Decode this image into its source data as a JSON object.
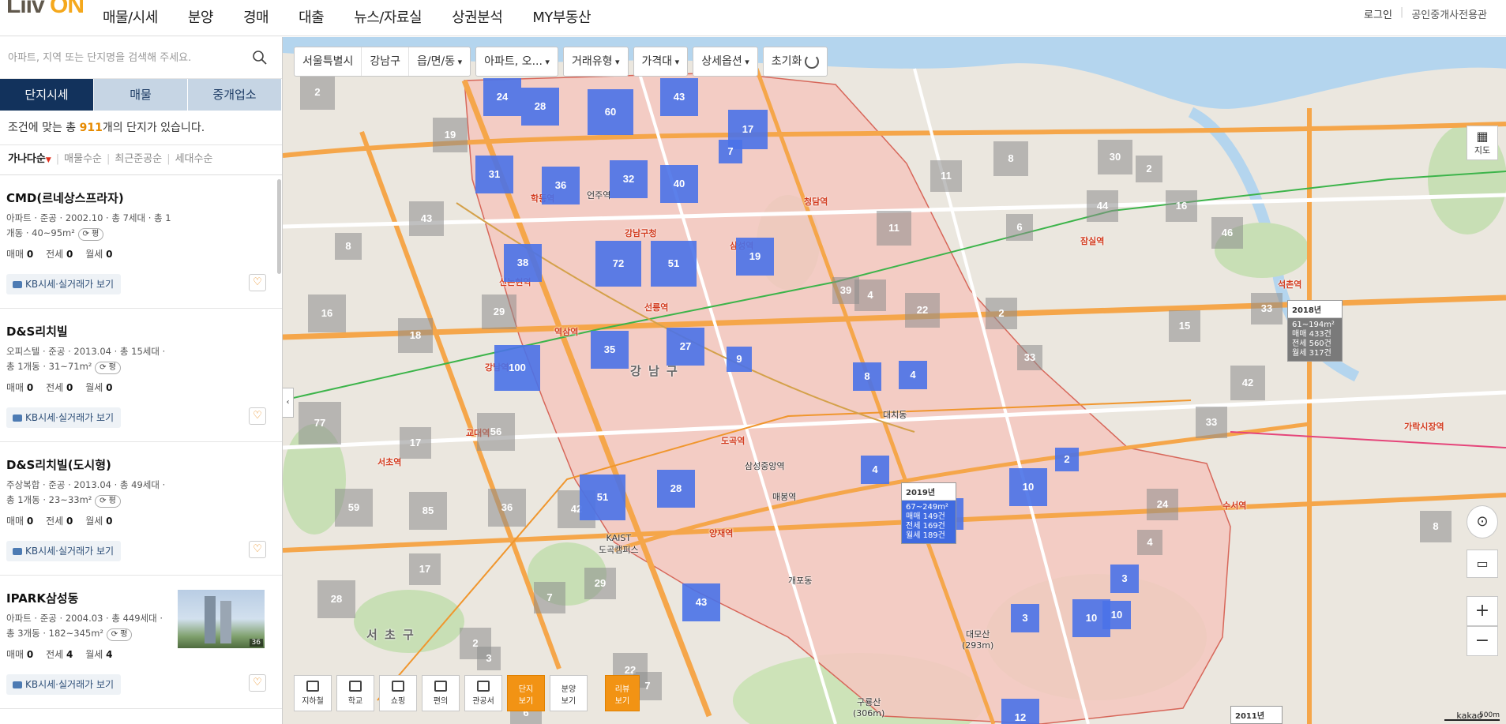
{
  "header": {
    "logo_a": "Liiv",
    "logo_b": "ON",
    "nav": [
      "매물/시세",
      "분양",
      "경매",
      "대출",
      "뉴스/자료실",
      "상권분석",
      "MY부동산"
    ],
    "login": "로그인",
    "agent": "공인중개사전용관"
  },
  "panel": {
    "search_placeholder": "아파트, 지역 또는 단지명을 검색해 주세요.",
    "tabs": [
      "단지시세",
      "매물",
      "중개업소"
    ],
    "count_prefix": "조건에 맞는 총 ",
    "count": "911",
    "count_suffix": "개의 단지가 있습니다.",
    "sort": [
      "가나다순",
      "매물수순",
      "최근준공순",
      "세대수순"
    ],
    "trade_labels": [
      "매매",
      "전세",
      "월세"
    ],
    "kb_label": "KB시세·실거래가 보기",
    "price_btn": "평",
    "items": [
      {
        "name": "CMD(르네상스프라자)",
        "meta1": "아파트 · 준공 · 2002.10 · 총 7세대 · 총 1",
        "meta2": "개동 · 40~95m²",
        "sale": "0",
        "jeonse": "0",
        "monthly": "0"
      },
      {
        "name": "D&S리치빌",
        "meta1": "오피스텔 · 준공 · 2013.04 · 총 15세대 ·",
        "meta2": "총 1개동 · 31~71m²",
        "sale": "0",
        "jeonse": "0",
        "monthly": "0"
      },
      {
        "name": "D&S리치빌(도시형)",
        "meta1": "주상복합 · 준공 · 2013.04 · 총 49세대 ·",
        "meta2": "총 1개동 · 23~33m²",
        "sale": "0",
        "jeonse": "0",
        "monthly": "0"
      },
      {
        "name": "IPARK삼성동",
        "meta1": "아파트 · 준공 · 2004.03 · 총 449세대 ·",
        "meta2": "총 3개동 · 182~345m²",
        "sale": "0",
        "jeonse": "4",
        "monthly": "4",
        "thumb_count": "36"
      }
    ]
  },
  "filters": [
    {
      "items": [
        "서울특별시",
        "강남구",
        "읍/면/동"
      ]
    },
    {
      "items": [
        "아파트, 오..."
      ]
    },
    {
      "items": [
        "거래유형"
      ]
    },
    {
      "items": [
        "가격대"
      ]
    },
    {
      "items": [
        "상세옵션"
      ]
    },
    {
      "items": [
        "초기화"
      ]
    }
  ],
  "clusters_blue": [
    "24",
    "28",
    "60",
    "43",
    "17",
    "31",
    "36",
    "32",
    "40",
    "7",
    "38",
    "72",
    "51",
    "19",
    "100",
    "35",
    "27",
    "9",
    "51",
    "28",
    "8",
    "4",
    "4",
    "6",
    "10",
    "2",
    "3",
    "3",
    "10",
    "10",
    "12",
    "43"
  ],
  "clusters_gray": [
    "2",
    "19",
    "43",
    "8",
    "16",
    "29",
    "18",
    "77",
    "56",
    "17",
    "59",
    "85",
    "36",
    "42",
    "17",
    "28",
    "11",
    "8",
    "30",
    "2",
    "44",
    "11",
    "6",
    "39",
    "4",
    "22",
    "2",
    "33",
    "15",
    "46",
    "16",
    "33",
    "42",
    "33",
    "24",
    "4",
    "29",
    "7",
    "2",
    "3",
    "22",
    "7",
    "6",
    "8"
  ],
  "popups": [
    {
      "year": "2019년",
      "area": "67~249m²",
      "sale": "매매 149건",
      "jeonse": "전세 169건",
      "monthly": "월세 189건"
    },
    {
      "year": "2018년",
      "area": "61~194m²",
      "sale": "매매 433건",
      "jeonse": "전세 560건",
      "monthly": "월세 317건"
    }
  ],
  "bottom_tools": [
    "지하철",
    "학교",
    "쇼핑",
    "편의",
    "관공서",
    "단지\n보기",
    "분양\n보기",
    "리뷰\n보기"
  ],
  "right_tools": {
    "map": "지도",
    "zoom_in": "+",
    "zoom_out": "−"
  },
  "map_labels": {
    "gangnam_station": "강남역",
    "yeoksam_station": "역삼역",
    "seolleung_station": "선릉역",
    "samseong_station": "삼성역",
    "seocho_station": "서초역",
    "gyodae_station": "교대역",
    "dogok_station": "도곡역",
    "sinnonhyeon": "신논현역",
    "cheongdam": "청담역",
    "gangnam_gu": "강 남 구",
    "seocho_gu": "서 초 구",
    "daemo": "대모산\n(293m)",
    "guryong": "구룡산\n(306m)",
    "jamsil": "잠실역",
    "suseo": "수서역",
    "garak": "가락시장역",
    "seokchon": "석촌역",
    "hakdong": "학동역",
    "gangnamgu_office": "강남구청",
    "eonju": "언주역",
    "maebong": "매봉역",
    "gaepo": "개포동",
    "daechi": "대치동",
    "yangjae": "양재역",
    "kakao": "kakao",
    "scale": "500m",
    "kaist": "KAIST\n도곡캠퍼스",
    "coex": "삼성중앙역"
  },
  "badge_2011": "2011년",
  "colors": {
    "brand": "#f5a81c",
    "tab_active": "#12325c",
    "cluster_blue": "#4a72e8",
    "gangnam_area": "#f4c7c0"
  }
}
